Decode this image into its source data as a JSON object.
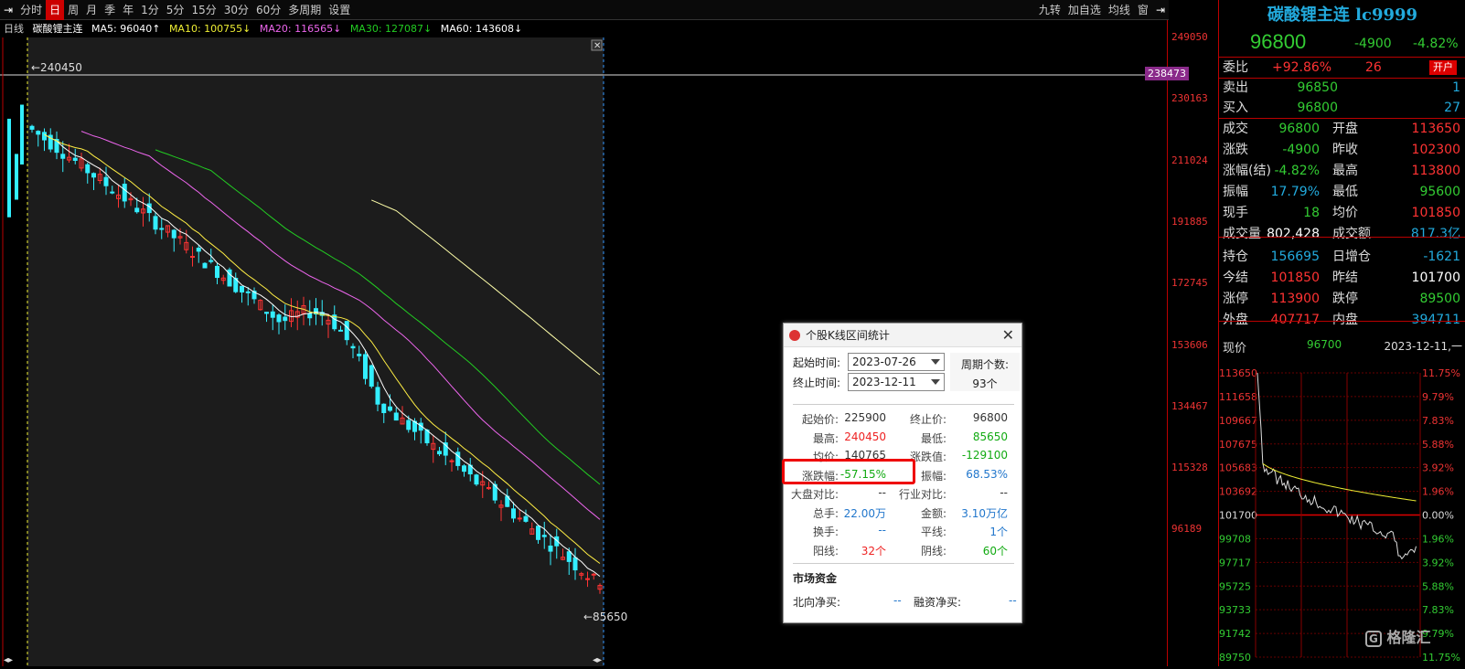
{
  "toolbar": {
    "left_items": [
      "分时",
      "日",
      "周",
      "月",
      "季",
      "年",
      "1分",
      "5分",
      "15分",
      "30分",
      "60分",
      "多周期",
      "设置"
    ],
    "active": "日",
    "right_items": [
      "九转",
      "加自选",
      "均线",
      "窗"
    ]
  },
  "ma_line": {
    "period": "日线",
    "name": "碳酸锂主连",
    "ma5": "MA5: 96040↑",
    "ma10": "MA10: 100755↓",
    "ma20": "MA20: 116565↓",
    "ma30": "MA30: 127087↓",
    "ma60": "MA60: 143608↓"
  },
  "colors": {
    "ma5": "#ffffff",
    "ma10": "#ffee44",
    "ma20": "#ee66ee",
    "ma30": "#22cc22",
    "ma60": "#ffffaa",
    "up": "#ff3333",
    "down": "#33eeff"
  },
  "chart_marks": {
    "high_label": "240450",
    "low_label": "85650",
    "cursor_price": "238473"
  },
  "y_axis": [
    "249050",
    "230163",
    "211024",
    "191885",
    "172745",
    "153606",
    "134467",
    "115328",
    "96189"
  ],
  "quote": {
    "title": "碳酸锂主连 lc9999",
    "price": "96800",
    "change": "-4900",
    "change_pct": "-4.82%",
    "weibi_label": "委比",
    "weibi_pct": "+92.86%",
    "weibi_num": "26",
    "open_btn": "开户",
    "sell_label": "卖出",
    "sell_price": "96850",
    "sell_vol": "1",
    "buy_label": "买入",
    "buy_price": "96800",
    "buy_vol": "27",
    "rows": [
      {
        "l1": "成交",
        "v1": "96800",
        "c1": "green",
        "l2": "开盘",
        "v2": "113650",
        "c2": "red"
      },
      {
        "l1": "涨跌",
        "v1": "-4900",
        "c1": "green",
        "l2": "昨收",
        "v2": "102300",
        "c2": "red"
      },
      {
        "l1": "涨幅(结)",
        "v1": "-4.82%",
        "c1": "green",
        "l2": "最高",
        "v2": "113800",
        "c2": "red"
      },
      {
        "l1": "振幅",
        "v1": "17.79%",
        "c1": "cyan",
        "l2": "最低",
        "v2": "95600",
        "c2": "green"
      },
      {
        "l1": "现手",
        "v1": "18",
        "c1": "green",
        "l2": "均价",
        "v2": "101850",
        "c2": "red"
      },
      {
        "l1": "成交量",
        "v1": "802,428",
        "c1": "white",
        "l2": "成交额",
        "v2": "817.3亿",
        "c2": "cyan"
      },
      {
        "l1": "持仓",
        "v1": "156695",
        "c1": "cyan",
        "l2": "日增仓",
        "v2": "-1621",
        "c2": "cyan"
      },
      {
        "l1": "今结",
        "v1": "101850",
        "c1": "red",
        "l2": "昨结",
        "v2": "101700",
        "c2": "white"
      },
      {
        "l1": "涨停",
        "v1": "113900",
        "c1": "red",
        "l2": "跌停",
        "v2": "89500",
        "c2": "green"
      },
      {
        "l1": "外盘",
        "v1": "407717",
        "c1": "red",
        "l2": "内盘",
        "v2": "394711",
        "c2": "cyan"
      }
    ],
    "now_label": "现价",
    "now_price": "96700",
    "now_date": "2023-12-11,一"
  },
  "mini_chart": {
    "left_ticks": [
      "113650",
      "111658",
      "109667",
      "107675",
      "105683",
      "103692",
      "101700",
      "99708",
      "97717",
      "95725",
      "93733",
      "91742",
      "89750"
    ],
    "right_ticks": [
      "11.75%",
      "9.79%",
      "7.83%",
      "5.88%",
      "3.92%",
      "1.96%",
      "0.00%",
      "1.96%",
      "3.92%",
      "5.88%",
      "7.83%",
      "9.79%",
      "11.75%"
    ],
    "watermark": "格隆汇"
  },
  "dialog": {
    "title": "个股K线区间统计",
    "start_label": "起始时间:",
    "start_value": "2023-07-26",
    "end_label": "终止时间:",
    "end_value": "2023-12-11",
    "period_label": "周期个数:",
    "period_value": "93个",
    "stats": [
      {
        "l1": "起始价:",
        "v1": "225900",
        "c1": "#333",
        "l2": "终止价:",
        "v2": "96800",
        "c2": "#333"
      },
      {
        "l1": "最高:",
        "v1": "240450",
        "c1": "#e22",
        "l2": "最低:",
        "v2": "85650",
        "c2": "#1a1"
      },
      {
        "l1": "均价:",
        "v1": "140765",
        "c1": "#333",
        "l2": "涨跌值:",
        "v2": "-129100",
        "c2": "#1a1"
      },
      {
        "l1": "涨跌幅:",
        "v1": "-57.15%",
        "c1": "#1a1",
        "l2": "振幅:",
        "v2": "68.53%",
        "c2": "#27c"
      },
      {
        "l1": "大盘对比:",
        "v1": "--",
        "c1": "#333",
        "l2": "行业对比:",
        "v2": "--",
        "c2": "#333"
      },
      {
        "l1": "总手:",
        "v1": "22.00万",
        "c1": "#27c",
        "l2": "金额:",
        "v2": "3.10万亿",
        "c2": "#27c"
      },
      {
        "l1": "换手:",
        "v1": "--",
        "c1": "#27c",
        "l2": "平线:",
        "v2": "1个",
        "c2": "#27c"
      },
      {
        "l1": "阳线:",
        "v1": "32个",
        "c1": "#e22",
        "l2": "阴线:",
        "v2": "60个",
        "c2": "#1a1"
      }
    ],
    "fund_title": "市场资金",
    "north_label": "北向净买:",
    "north_value": "--",
    "margin_label": "融资净买:",
    "margin_value": "--"
  }
}
